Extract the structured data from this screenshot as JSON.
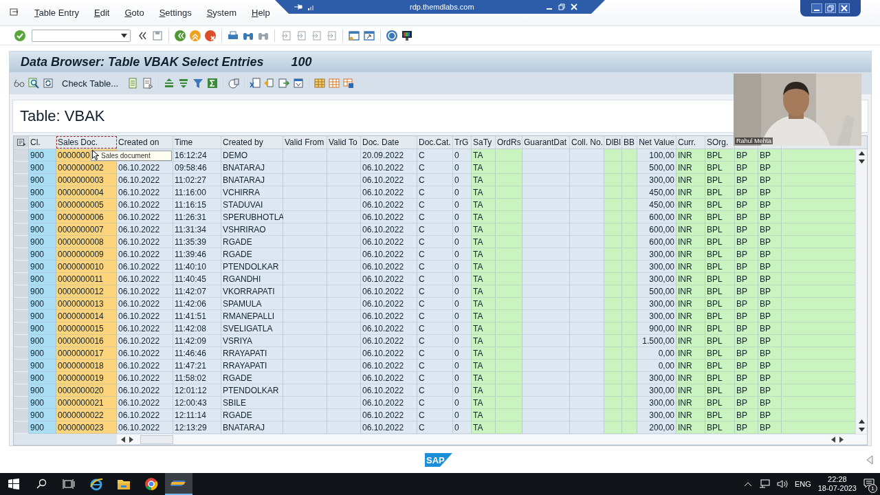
{
  "rdp_bar": {
    "host": "rdp.themdlabs.com"
  },
  "menu": [
    "Table Entry",
    "Edit",
    "Goto",
    "Settings",
    "System",
    "Help"
  ],
  "title": {
    "text": "Data Browser: Table VBAK Select Entries",
    "count": "100"
  },
  "app_toolbar": {
    "button": "Check Table..."
  },
  "table_title": "Table: VBAK",
  "webcam": {
    "kind": "picture",
    "name": "Rahul Mehta"
  },
  "tooltip": "Sales document",
  "table": {
    "columns": [
      {
        "label": "Cl.",
        "color": "#a9def4",
        "kind": "text"
      },
      {
        "label": "Sales Doc.",
        "color": "#fbd47c",
        "kind": "text"
      },
      {
        "label": "Created on",
        "color": "#dde8f2",
        "kind": "text"
      },
      {
        "label": "Time",
        "color": "#dde8f2",
        "kind": "text"
      },
      {
        "label": "Created by",
        "color": "#dde8f2",
        "kind": "text"
      },
      {
        "label": "Valid From",
        "color": "#dde8f2",
        "kind": "text"
      },
      {
        "label": "Valid To",
        "color": "#dde8f2",
        "kind": "text"
      },
      {
        "label": "Doc. Date",
        "color": "#dde8f2",
        "kind": "text"
      },
      {
        "label": "Doc.Cat.",
        "color": "#dde8f2",
        "kind": "text"
      },
      {
        "label": "TrG",
        "color": "#dde8f2",
        "kind": "text"
      },
      {
        "label": "SaTy",
        "color": "#c9f3bf",
        "kind": "text"
      },
      {
        "label": "OrdRs",
        "color": "#c9f3bf",
        "kind": "text"
      },
      {
        "label": "GuarantDat",
        "color": "#dde8f2",
        "kind": "text"
      },
      {
        "label": "Coll. No.",
        "color": "#dde8f2",
        "kind": "text"
      },
      {
        "label": "DlBl",
        "color": "#c9f3bf",
        "kind": "text"
      },
      {
        "label": "BB",
        "color": "#c9f3bf",
        "kind": "text"
      },
      {
        "label": "Net Value",
        "color": "#dde8f2",
        "kind": "amount"
      },
      {
        "label": "Curr.",
        "color": "#c9f3bf",
        "kind": "text"
      },
      {
        "label": "SOrg.",
        "color": "#c9f3bf",
        "kind": "text"
      },
      {
        "color": "#c9f3bf",
        "kind": "text"
      },
      {
        "color": "#c9f3bf",
        "kind": "text"
      }
    ],
    "rows": [
      [
        "900",
        "0000000",
        null,
        "16:12:24",
        "DEMO",
        null,
        null,
        "20.09.2022",
        "C",
        "0",
        "TA",
        null,
        null,
        null,
        null,
        null,
        "100,00",
        "INR",
        "BPL",
        "BP",
        "BP"
      ],
      [
        "900",
        "0000000002",
        "06.10.2022",
        "09:58:46",
        "BNATARAJ",
        null,
        null,
        "06.10.2022",
        "C",
        "0",
        "TA",
        null,
        null,
        null,
        null,
        null,
        "500,00",
        "INR",
        "BPL",
        "BP",
        "BP"
      ],
      [
        "900",
        "0000000003",
        "06.10.2022",
        "11:02:27",
        "BNATARAJ",
        null,
        null,
        "06.10.2022",
        "C",
        "0",
        "TA",
        null,
        null,
        null,
        null,
        null,
        "300,00",
        "INR",
        "BPL",
        "BP",
        "BP"
      ],
      [
        "900",
        "0000000004",
        "06.10.2022",
        "11:16:00",
        "VCHIRRA",
        null,
        null,
        "06.10.2022",
        "C",
        "0",
        "TA",
        null,
        null,
        null,
        null,
        null,
        "450,00",
        "INR",
        "BPL",
        "BP",
        "BP"
      ],
      [
        "900",
        "0000000005",
        "06.10.2022",
        "11:16:15",
        "STADUVAI",
        null,
        null,
        "06.10.2022",
        "C",
        "0",
        "TA",
        null,
        null,
        null,
        null,
        null,
        "450,00",
        "INR",
        "BPL",
        "BP",
        "BP"
      ],
      [
        "900",
        "0000000006",
        "06.10.2022",
        "11:26:31",
        "SPERUBHOTLA",
        null,
        null,
        "06.10.2022",
        "C",
        "0",
        "TA",
        null,
        null,
        null,
        null,
        null,
        "600,00",
        "INR",
        "BPL",
        "BP",
        "BP"
      ],
      [
        "900",
        "0000000007",
        "06.10.2022",
        "11:31:34",
        "VSHRIRAO",
        null,
        null,
        "06.10.2022",
        "C",
        "0",
        "TA",
        null,
        null,
        null,
        null,
        null,
        "600,00",
        "INR",
        "BPL",
        "BP",
        "BP"
      ],
      [
        "900",
        "0000000008",
        "06.10.2022",
        "11:35:39",
        "RGADE",
        null,
        null,
        "06.10.2022",
        "C",
        "0",
        "TA",
        null,
        null,
        null,
        null,
        null,
        "600,00",
        "INR",
        "BPL",
        "BP",
        "BP"
      ],
      [
        "900",
        "0000000009",
        "06.10.2022",
        "11:39:46",
        "RGADE",
        null,
        null,
        "06.10.2022",
        "C",
        "0",
        "TA",
        null,
        null,
        null,
        null,
        null,
        "300,00",
        "INR",
        "BPL",
        "BP",
        "BP"
      ],
      [
        "900",
        "0000000010",
        "06.10.2022",
        "11:40:10",
        "PTENDOLKAR",
        null,
        null,
        "06.10.2022",
        "C",
        "0",
        "TA",
        null,
        null,
        null,
        null,
        null,
        "300,00",
        "INR",
        "BPL",
        "BP",
        "BP"
      ],
      [
        "900",
        "0000000011",
        "06.10.2022",
        "11:40:45",
        "RGANDHI",
        null,
        null,
        "06.10.2022",
        "C",
        "0",
        "TA",
        null,
        null,
        null,
        null,
        null,
        "300,00",
        "INR",
        "BPL",
        "BP",
        "BP"
      ],
      [
        "900",
        "0000000012",
        "06.10.2022",
        "11:42:07",
        "VKORRAPATI",
        null,
        null,
        "06.10.2022",
        "C",
        "0",
        "TA",
        null,
        null,
        null,
        null,
        null,
        "500,00",
        "INR",
        "BPL",
        "BP",
        "BP"
      ],
      [
        "900",
        "0000000013",
        "06.10.2022",
        "11:42:06",
        "SPAMULA",
        null,
        null,
        "06.10.2022",
        "C",
        "0",
        "TA",
        null,
        null,
        null,
        null,
        null,
        "300,00",
        "INR",
        "BPL",
        "BP",
        "BP"
      ],
      [
        "900",
        "0000000014",
        "06.10.2022",
        "11:41:51",
        "RMANEPALLI",
        null,
        null,
        "06.10.2022",
        "C",
        "0",
        "TA",
        null,
        null,
        null,
        null,
        null,
        "300,00",
        "INR",
        "BPL",
        "BP",
        "BP"
      ],
      [
        "900",
        "0000000015",
        "06.10.2022",
        "11:42:08",
        "SVELIGATLA",
        null,
        null,
        "06.10.2022",
        "C",
        "0",
        "TA",
        null,
        null,
        null,
        null,
        null,
        "900,00",
        "INR",
        "BPL",
        "BP",
        "BP"
      ],
      [
        "900",
        "0000000016",
        "06.10.2022",
        "11:42:09",
        "VSRIYA",
        null,
        null,
        "06.10.2022",
        "C",
        "0",
        "TA",
        null,
        null,
        null,
        null,
        null,
        "1.500,00",
        "INR",
        "BPL",
        "BP",
        "BP"
      ],
      [
        "900",
        "0000000017",
        "06.10.2022",
        "11:46:46",
        "RRAYAPATI",
        null,
        null,
        "06.10.2022",
        "C",
        "0",
        "TA",
        null,
        null,
        null,
        null,
        null,
        "0,00",
        "INR",
        "BPL",
        "BP",
        "BP"
      ],
      [
        "900",
        "0000000018",
        "06.10.2022",
        "11:47:21",
        "RRAYAPATI",
        null,
        null,
        "06.10.2022",
        "C",
        "0",
        "TA",
        null,
        null,
        null,
        null,
        null,
        "0,00",
        "INR",
        "BPL",
        "BP",
        "BP"
      ],
      [
        "900",
        "0000000019",
        "06.10.2022",
        "11:58:02",
        "RGADE",
        null,
        null,
        "06.10.2022",
        "C",
        "0",
        "TA",
        null,
        null,
        null,
        null,
        null,
        "300,00",
        "INR",
        "BPL",
        "BP",
        "BP"
      ],
      [
        "900",
        "0000000020",
        "06.10.2022",
        "12:01:12",
        "PTENDOLKAR",
        null,
        null,
        "06.10.2022",
        "C",
        "0",
        "TA",
        null,
        null,
        null,
        null,
        null,
        "300,00",
        "INR",
        "BPL",
        "BP",
        "BP"
      ],
      [
        "900",
        "0000000021",
        "06.10.2022",
        "12:00:43",
        "SBILE",
        null,
        null,
        "06.10.2022",
        "C",
        "0",
        "TA",
        null,
        null,
        null,
        null,
        null,
        "300,00",
        "INR",
        "BPL",
        "BP",
        "BP"
      ],
      [
        "900",
        "0000000022",
        "06.10.2022",
        "12:11:14",
        "RGADE",
        null,
        null,
        "06.10.2022",
        "C",
        "0",
        "TA",
        null,
        null,
        null,
        null,
        null,
        "300,00",
        "INR",
        "BPL",
        "BP",
        "BP"
      ],
      [
        "900",
        "0000000023",
        "06.10.2022",
        "12:13:29",
        "BNATARAJ",
        null,
        null,
        "06.10.2022",
        "C",
        "0",
        "TA",
        null,
        null,
        null,
        null,
        null,
        "200,00",
        "INR",
        "BPL",
        "BP",
        "BP"
      ]
    ]
  },
  "sap_logo": "SAP",
  "taskbar": {
    "apps": [
      {
        "kind": "e-browser",
        "selected": false
      },
      {
        "kind": "folder",
        "selected": false
      },
      {
        "kind": "round-browser",
        "selected": false
      },
      {
        "kind": "sap-gui",
        "selected": true
      }
    ],
    "language": "ENG",
    "time": "22:28",
    "date": "18-07-2023",
    "notifications": "1"
  }
}
